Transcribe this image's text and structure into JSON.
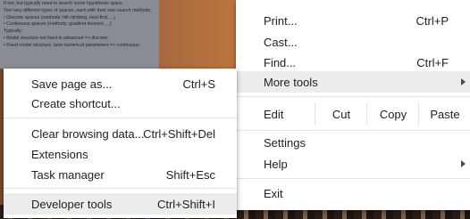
{
  "background_doc": {
    "lines": [
      "If not, but typically need to search some hypothesis space",
      "Two very different types of spaces, each with their own search methods:",
      "• Discrete spaces (methods: hill-climbing, best-first, ...)",
      "• Continuous spaces (methods: gradient descent, ...)",
      "Typically:",
      "• Model structure not fixed in advanced => discrete",
      "• Fixed model structure, tune numerical parameters => continuous"
    ]
  },
  "main_menu": {
    "print": {
      "label": "Print...",
      "shortcut": "Ctrl+P"
    },
    "cast": {
      "label": "Cast..."
    },
    "find": {
      "label": "Find...",
      "shortcut": "Ctrl+F"
    },
    "more_tools": {
      "label": "More tools"
    },
    "edit": {
      "label": "Edit",
      "cut": "Cut",
      "copy": "Copy",
      "paste": "Paste"
    },
    "settings": {
      "label": "Settings"
    },
    "help": {
      "label": "Help"
    },
    "exit": {
      "label": "Exit"
    }
  },
  "more_tools_menu": {
    "save_page": {
      "label": "Save page as...",
      "shortcut": "Ctrl+S"
    },
    "create_shortcut": {
      "label": "Create shortcut..."
    },
    "clear_data": {
      "label": "Clear browsing data...",
      "shortcut": "Ctrl+Shift+Del"
    },
    "extensions": {
      "label": "Extensions"
    },
    "task_manager": {
      "label": "Task manager",
      "shortcut": "Shift+Esc"
    },
    "dev_tools": {
      "label": "Developer tools",
      "shortcut": "Ctrl+Shift+I"
    }
  }
}
